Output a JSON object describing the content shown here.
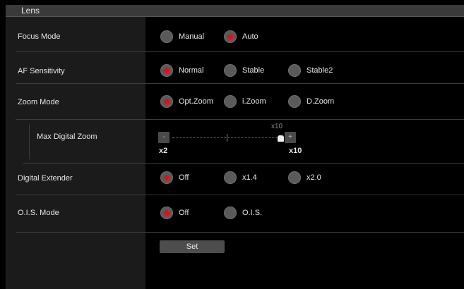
{
  "panel": {
    "title": "Lens"
  },
  "settings": [
    {
      "label": "Focus Mode",
      "options": [
        "Manual",
        "Auto"
      ],
      "selected": "Auto"
    },
    {
      "label": "AF Sensitivity",
      "options": [
        "Normal",
        "Stable",
        "Stable2"
      ],
      "selected": "Normal"
    },
    {
      "label": "Zoom Mode",
      "options": [
        "Opt.Zoom",
        "i.Zoom",
        "D.Zoom"
      ],
      "selected": "Opt.Zoom"
    },
    {
      "label": "Digital Extender",
      "options": [
        "Off",
        "x1.4",
        "x2.0"
      ],
      "selected": "Off"
    },
    {
      "label": "O.I.S. Mode",
      "options": [
        "Off",
        "O.I.S."
      ],
      "selected": "Off"
    }
  ],
  "max_digital_zoom": {
    "label": "Max Digital Zoom",
    "minus": "-",
    "plus": "+",
    "current_marker": "x10",
    "min_label": "x2",
    "max_label": "x10",
    "value": 10,
    "min": 2,
    "max": 10
  },
  "set_button": "Set"
}
